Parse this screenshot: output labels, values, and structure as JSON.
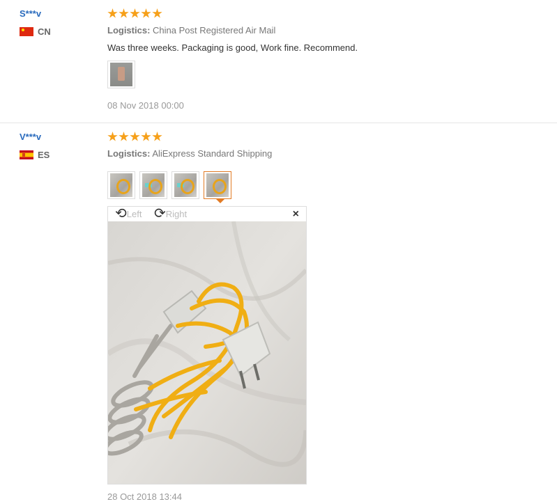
{
  "colors": {
    "username": "#2a6bbd",
    "star": "#f6a01a",
    "active_border": "#e27b24",
    "muted": "#999999"
  },
  "reviews": [
    {
      "user": "S***v",
      "country": "CN",
      "flag": "china-flag",
      "stars": 5,
      "logistics_label": "Logistics:",
      "logistics_value": "China Post Registered Air Mail",
      "text": "Was three weeks. Packaging is good, Work fine. Recommend.",
      "date": "08 Nov 2018 00:00"
    },
    {
      "user": "V***v",
      "country": "ES",
      "flag": "spain-flag",
      "stars": 5,
      "logistics_label": "Logistics:",
      "logistics_value": "AliExpress Standard Shipping",
      "date": "28 Oct 2018 13:44",
      "viewer": {
        "rotate_left": "Left",
        "rotate_right": "Right",
        "close": "×"
      }
    }
  ]
}
